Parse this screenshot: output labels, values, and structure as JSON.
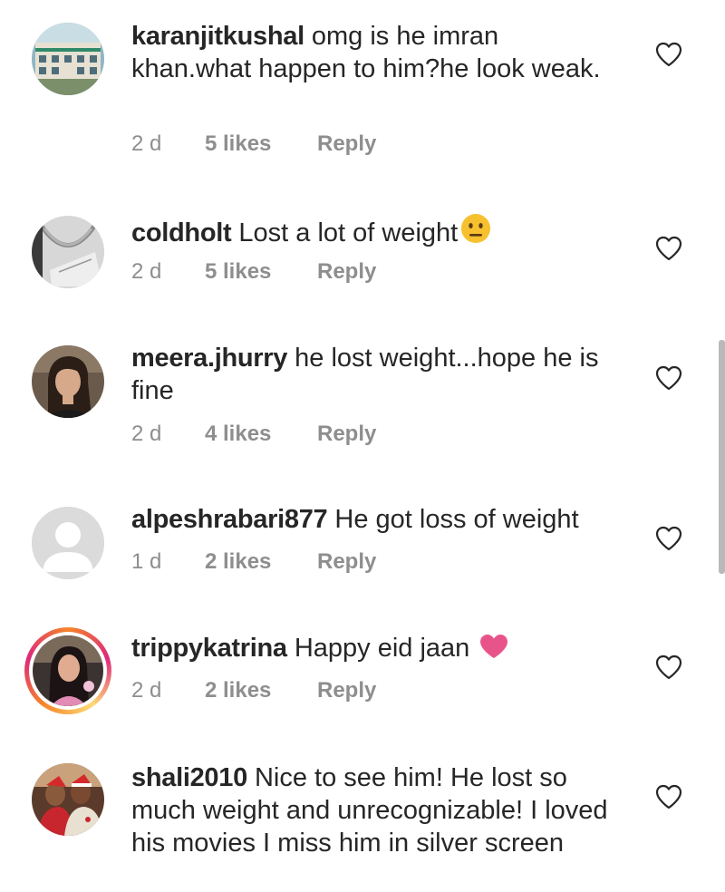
{
  "comments": [
    {
      "username": "karanjitkushal",
      "text": "omg is he imran khan.what happen to him?he look weak.",
      "time": "2 d",
      "likes": "5 likes",
      "reply": "Reply",
      "emoji": ""
    },
    {
      "username": "coldholt",
      "text": "Lost a lot of weight",
      "time": "2 d",
      "likes": "5 likes",
      "reply": "Reply",
      "emoji": "neutral-face-emoji"
    },
    {
      "username": "meera.jhurry",
      "text": "he lost weight...hope he is fine",
      "time": "2 d",
      "likes": "4 likes",
      "reply": "Reply",
      "emoji": ""
    },
    {
      "username": "alpeshrabari877",
      "text": "He got loss of weight",
      "time": "1 d",
      "likes": "2 likes",
      "reply": "Reply",
      "emoji": ""
    },
    {
      "username": "trippykatrina",
      "text": "Happy eid jaan",
      "time": "2 d",
      "likes": "2 likes",
      "reply": "Reply",
      "emoji": "pink-heart-emoji"
    },
    {
      "username": "shali2010",
      "text": "Nice to see him! He lost so much weight and unrecognizable! I loved his movies I miss him in silver screen",
      "time": "",
      "likes": "",
      "reply": "",
      "emoji": ""
    }
  ],
  "colors": {
    "text": "#262626",
    "meta": "#8e8e8e",
    "heart_outline": "#262626",
    "pink_heart": "#e8548a",
    "story_ring_start": "#f58529",
    "story_ring_end": "#dd2a7b"
  },
  "icons": {
    "like": "heart-outline-icon"
  }
}
